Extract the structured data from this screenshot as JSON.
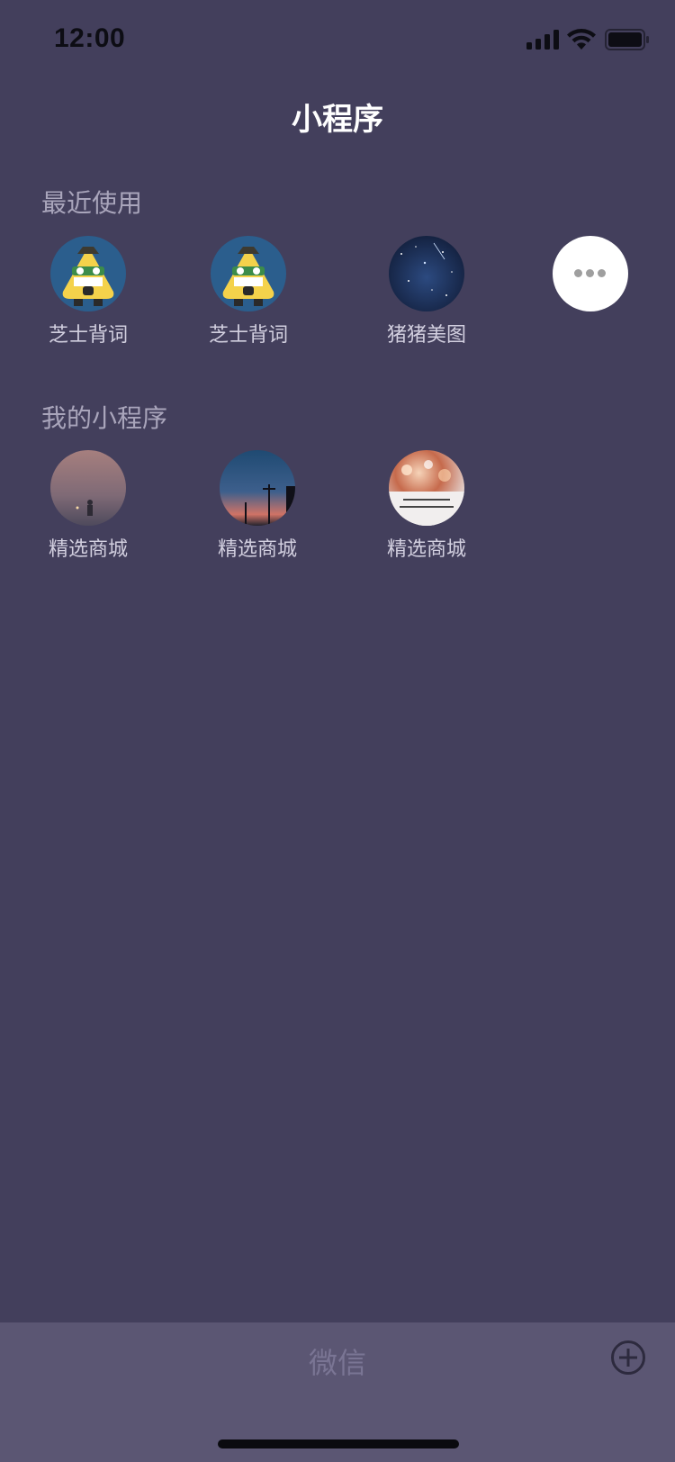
{
  "status_bar": {
    "time": "12:00",
    "icons": [
      "signal-icon",
      "wifi-icon",
      "battery-icon"
    ]
  },
  "header": {
    "title": "小程序"
  },
  "sections": {
    "recent": {
      "title": "最近使用",
      "items": [
        {
          "label": "芝士背词",
          "icon": "cheese-mascot-avatar"
        },
        {
          "label": "芝士背词",
          "icon": "cheese-mascot-avatar"
        },
        {
          "label": "猪猪美图",
          "icon": "starry-sky-avatar"
        }
      ],
      "more_icon": "more-dots-icon"
    },
    "mine": {
      "title": "我的小程序",
      "items": [
        {
          "label": "精选商城",
          "icon": "dusk-figure-avatar"
        },
        {
          "label": "精选商城",
          "icon": "sunset-poles-avatar"
        },
        {
          "label": "精选商城",
          "icon": "bokeh-text-avatar"
        }
      ]
    }
  },
  "bottom_bar": {
    "title": "微信",
    "add_icon": "plus-circle-icon"
  },
  "colors": {
    "background": "#433f5c",
    "bottom_bar": "#5b5673",
    "section_title": "#a9a5bb",
    "label": "#d2cfdf"
  }
}
